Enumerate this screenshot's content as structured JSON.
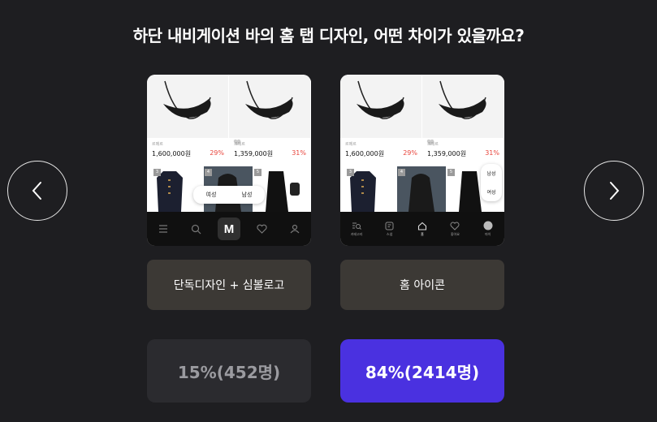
{
  "question": "하단 내비게이션 바의 홈 탭 디자인, 어떤 차이가 있을까요?",
  "options": [
    {
      "label": "단독디자인 + 심볼로고",
      "result": "15%(452명)",
      "percent": 15,
      "selected": false,
      "preview": {
        "items": [
          {
            "brand": "르메르",
            "price": "1,600,000원",
            "discount": "29%"
          },
          {
            "brand": "르메르",
            "price": "1,359,000원",
            "discount": "31%"
          }
        ],
        "ranks": [
          "3",
          "4",
          "5"
        ],
        "gender_toggle": [
          "여성",
          "남성"
        ],
        "logo": "M"
      }
    },
    {
      "label": "홈 아이콘",
      "result": "84%(2414명)",
      "percent": 84,
      "selected": true,
      "preview": {
        "items": [
          {
            "brand": "르메르",
            "price": "1,600,000원",
            "discount": "29%"
          },
          {
            "brand": "르메르",
            "price": "1,359,000원",
            "discount": "31%"
          }
        ],
        "ranks": [
          "3",
          "4",
          "5"
        ],
        "gender_toggle": [
          "남성",
          "여성"
        ],
        "tabs": [
          "카테고리",
          "스냅",
          "홈",
          "좋아요",
          "마이"
        ]
      }
    }
  ],
  "colors": {
    "background": "#1e1e21",
    "option_button": "#3c3935",
    "result_selected": "#4a31e0",
    "result_unselected": "#2b2b2f",
    "discount": "#e8453c"
  },
  "icons": {
    "prev": "chevron-left-icon",
    "next": "chevron-right-icon"
  }
}
